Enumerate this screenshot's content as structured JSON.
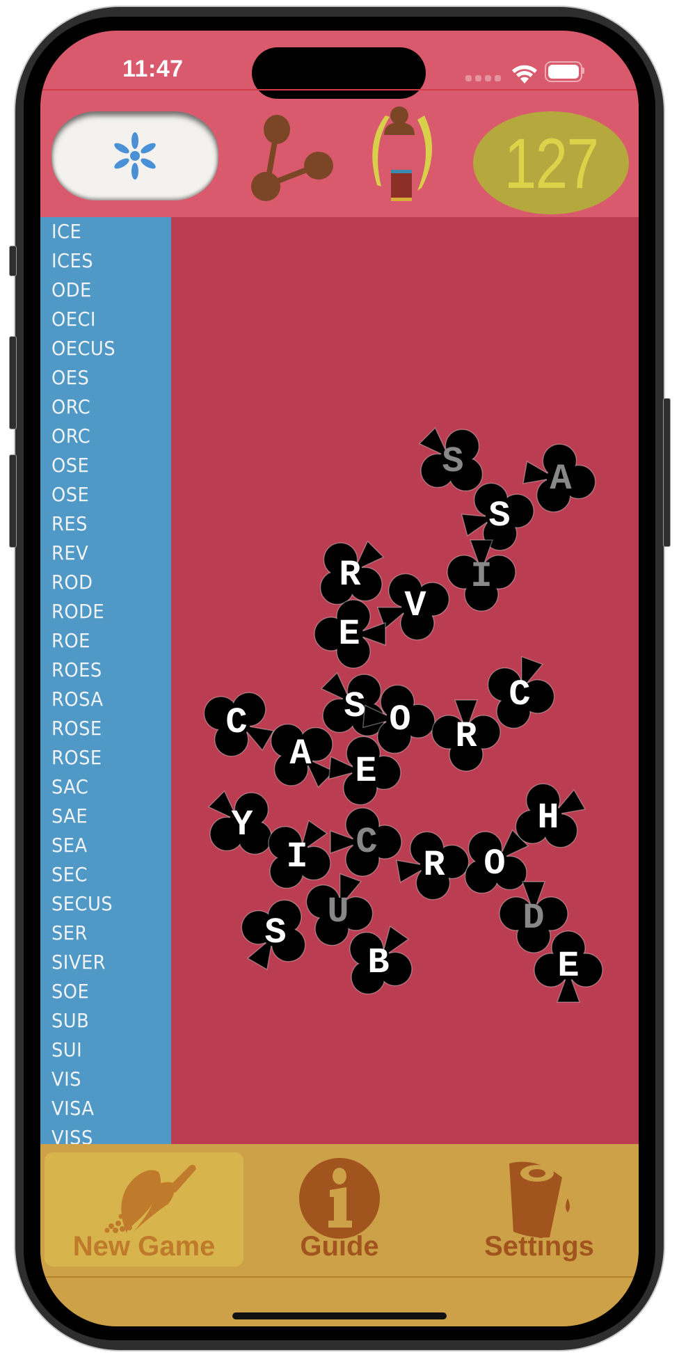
{
  "status_bar": {
    "time": "11:47",
    "icons": [
      "cellular-signal-icon",
      "wifi-icon",
      "battery-icon"
    ]
  },
  "header": {
    "hint_button_icon": "sparkle-icon",
    "tree_button_icon": "molecule-tree-icon",
    "player_button_icon": "player-badge-icon",
    "score": "127"
  },
  "colors": {
    "header_bg": "#d95a6c",
    "sidebar_bg": "#5099c7",
    "board_bg": "#bb3d51",
    "tabbar_bg": "#cca147",
    "tab_active_bg": "#d8b54c",
    "score_bg": "#b5a83e",
    "score_text": "#dcd34a",
    "tile_fill": "#000000",
    "tile_letter_active": "#ffffff",
    "tile_letter_inactive": "#888888",
    "icon_brown": "#7a4626",
    "tab_icon_active": "#bf7a2c",
    "tab_icon": "#a2541e"
  },
  "word_list": [
    "ICE",
    "ICES",
    "ODE",
    "OECI",
    "OECUS",
    "OES",
    "ORC",
    "ORC",
    "OSE",
    "OSE",
    "RES",
    "REV",
    "ROD",
    "RODE",
    "ROE",
    "ROES",
    "ROSA",
    "ROSE",
    "ROSE",
    "SAC",
    "SAE",
    "SEA",
    "SEC",
    "SECUS",
    "SER",
    "SIVER",
    "SOE",
    "SUB",
    "SUI",
    "VIS",
    "VISA",
    "VISS"
  ],
  "tiles": [
    {
      "letter": "S",
      "active": false
    },
    {
      "letter": "A",
      "active": false
    },
    {
      "letter": "S",
      "active": true
    },
    {
      "letter": "I",
      "active": false
    },
    {
      "letter": "R",
      "active": true
    },
    {
      "letter": "V",
      "active": true
    },
    {
      "letter": "E",
      "active": true
    },
    {
      "letter": "S",
      "active": true
    },
    {
      "letter": "O",
      "active": true
    },
    {
      "letter": "C",
      "active": true
    },
    {
      "letter": "A",
      "active": true
    },
    {
      "letter": "E",
      "active": true
    },
    {
      "letter": "R",
      "active": true
    },
    {
      "letter": "C",
      "active": true
    },
    {
      "letter": "Y",
      "active": true
    },
    {
      "letter": "I",
      "active": true
    },
    {
      "letter": "C",
      "active": false
    },
    {
      "letter": "R",
      "active": true
    },
    {
      "letter": "O",
      "active": true
    },
    {
      "letter": "H",
      "active": true
    },
    {
      "letter": "U",
      "active": false
    },
    {
      "letter": "S",
      "active": true
    },
    {
      "letter": "B",
      "active": true
    },
    {
      "letter": "D",
      "active": false
    },
    {
      "letter": "E",
      "active": true
    }
  ],
  "tabbar": {
    "tabs": [
      {
        "label": "New Game",
        "icon": "scoop-icon",
        "active": true
      },
      {
        "label": "Guide",
        "icon": "info-icon",
        "active": false
      },
      {
        "label": "Settings",
        "icon": "coffee-cup-icon",
        "active": false
      }
    ]
  }
}
